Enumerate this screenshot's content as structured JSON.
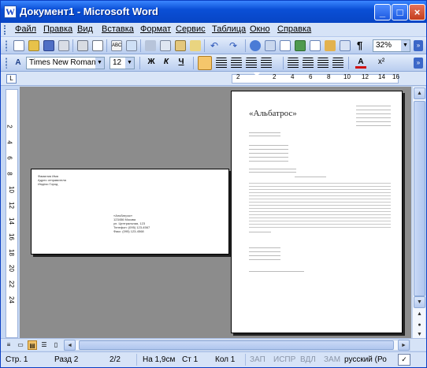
{
  "window": {
    "title": "Документ1 - Microsoft Word",
    "app_icon": "W",
    "buttons": {
      "minimize": "_",
      "maximize": "□",
      "close": "×"
    }
  },
  "menu": {
    "items": [
      "Файл",
      "Правка",
      "Вид",
      "Вставка",
      "Формат",
      "Сервис",
      "Таблица",
      "Окно",
      "Справка"
    ]
  },
  "toolbar_standard": {
    "zoom": "32%",
    "paragraph_mark": "¶"
  },
  "toolbar_formatting": {
    "style": "А",
    "font_name": "Times New Roman",
    "font_size": "12",
    "bold": "Ж",
    "italic": "К",
    "underline": "Ч",
    "font_color_glyph": "A",
    "superscript": "x²"
  },
  "ruler": {
    "ticks": [
      "2",
      "2",
      "4",
      "6",
      "8",
      "10",
      "12",
      "14",
      "16"
    ],
    "vertical_ticks": [
      "2",
      "4",
      "6",
      "8",
      "10",
      "12",
      "14",
      "16",
      "18",
      "20",
      "22",
      "24"
    ]
  },
  "document": {
    "envelope": {
      "return_address": "Фамилия Имя\nАдрес отправителя\nИндекс Город",
      "recipient": "«Альбатрос»\n123456 Москва\nул. Центральная, 123\nТелефон: (095) 123-4567\nФакс: (095) 123-4568"
    },
    "letter": {
      "logo": "«Альбатрос»"
    }
  },
  "statusbar": {
    "page": "Стр. 1",
    "section": "Разд 2",
    "pages": "2/2",
    "at": "На 1,9см",
    "line": "Ст 1",
    "col": "Кол 1",
    "rec": "ЗАП",
    "trk": "ИСПР",
    "ext": "ВДЛ",
    "ovr": "ЗАМ",
    "language": "русский (Ро"
  },
  "colors": {
    "title_bar": "#0a4fd6",
    "workspace": "#8c8c8c",
    "toolbar": "#c5d7f3"
  }
}
